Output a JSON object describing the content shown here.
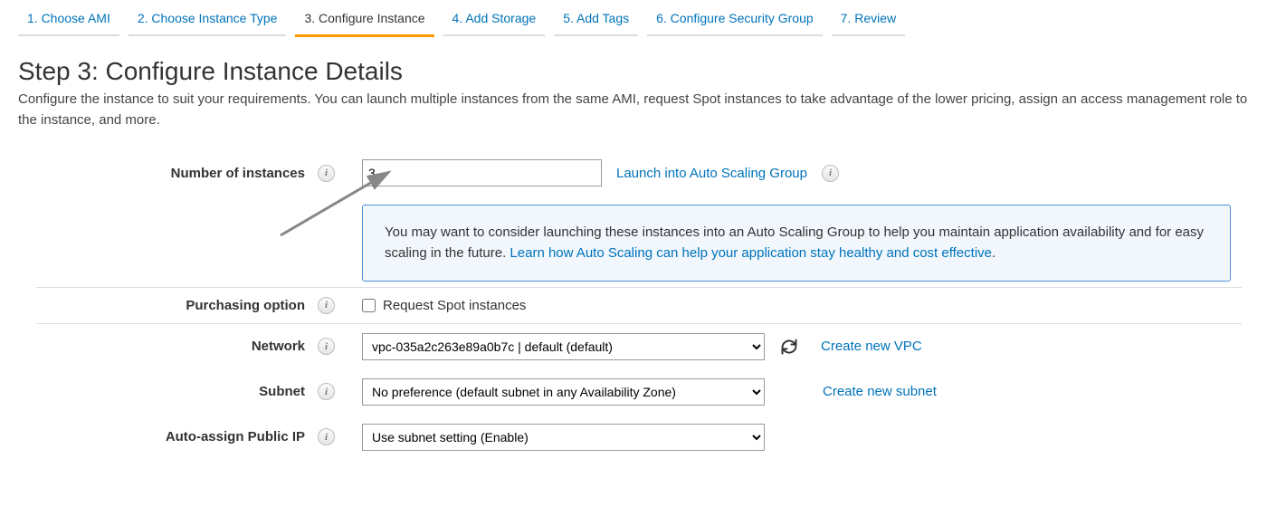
{
  "wizard": {
    "steps": [
      "1. Choose AMI",
      "2. Choose Instance Type",
      "3. Configure Instance",
      "4. Add Storage",
      "5. Add Tags",
      "6. Configure Security Group",
      "7. Review"
    ],
    "active_index": 2
  },
  "page": {
    "title": "Step 3: Configure Instance Details",
    "description": "Configure the instance to suit your requirements. You can launch multiple instances from the same AMI, request Spot instances to take advantage of the lower pricing, assign an access management role to the instance, and more."
  },
  "form": {
    "num_instances": {
      "label": "Number of instances",
      "value": "3",
      "asg_link": "Launch into Auto Scaling Group"
    },
    "notice": {
      "text": "You may want to consider launching these instances into an Auto Scaling Group to help you maintain application availability and for easy scaling in the future. ",
      "link_text": "Learn how Auto Scaling can help your application stay healthy and cost effective",
      "period": "."
    },
    "purchasing": {
      "label": "Purchasing option",
      "checkbox_label": "Request Spot instances"
    },
    "network": {
      "label": "Network",
      "value": "vpc-035a2c263e89a0b7c | default (default)",
      "create_link": "Create new VPC"
    },
    "subnet": {
      "label": "Subnet",
      "value": "No preference (default subnet in any Availability Zone)",
      "create_link": "Create new subnet"
    },
    "public_ip": {
      "label": "Auto-assign Public IP",
      "value": "Use subnet setting (Enable)"
    }
  }
}
